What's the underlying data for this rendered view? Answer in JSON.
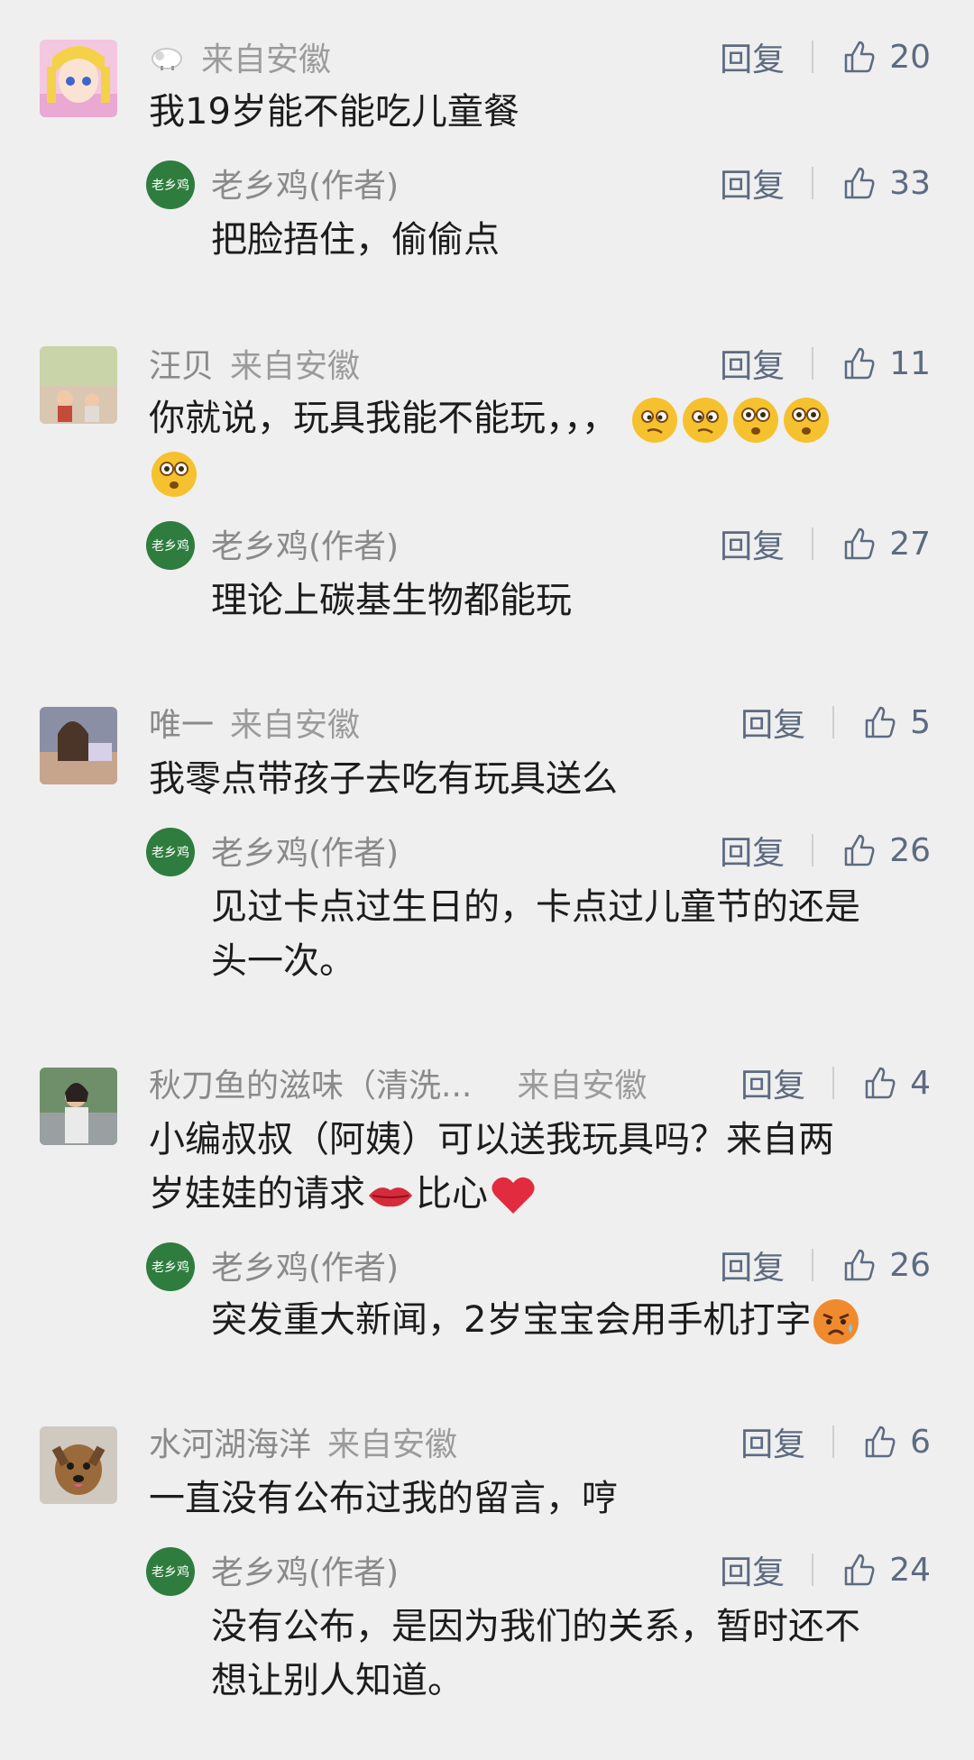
{
  "reply_label": "回复",
  "author_badge": "老乡鸡",
  "comments": [
    {
      "name": "",
      "region": "来自安徽",
      "likes": "20",
      "text": "我19岁能不能吃儿童餐",
      "reply": {
        "name": "老乡鸡(作者)",
        "likes": "33",
        "text": "把脸捂住，偷偷点"
      }
    },
    {
      "name": "汪贝",
      "region": "来自安徽",
      "likes": "11",
      "text": "你就说，玩具我能不能玩，，，",
      "reply": {
        "name": "老乡鸡(作者)",
        "likes": "27",
        "text": "理论上碳基生物都能玩"
      }
    },
    {
      "name": "唯一",
      "region": "来自安徽",
      "likes": "5",
      "text": "我零点带孩子去吃有玩具送么",
      "reply": {
        "name": "老乡鸡(作者)",
        "likes": "26",
        "text_line1": "见过卡点过生日的，卡点过儿童节的还是",
        "text_line2": "头一次。"
      }
    },
    {
      "name": "秋刀鱼的滋味（清洗...",
      "region": "来自安徽",
      "likes": "4",
      "text_line1": "小编叔叔（阿姨）可以送我玩具吗？来自两",
      "text_line2_a": "岁娃娃的请求",
      "text_line2_b": "比心",
      "reply": {
        "name": "老乡鸡(作者)",
        "likes": "26",
        "text": "突发重大新闻，2岁宝宝会用手机打字"
      }
    },
    {
      "name": "水河湖海洋",
      "region": "来自安徽",
      "likes": "6",
      "text": "一直没有公布过我的留言，哼",
      "reply": {
        "name": "老乡鸡(作者)",
        "likes": "24",
        "text_line1": "没有公布，是因为我们的关系，暂时还不",
        "text_line2": "想让别人知道。"
      }
    }
  ]
}
